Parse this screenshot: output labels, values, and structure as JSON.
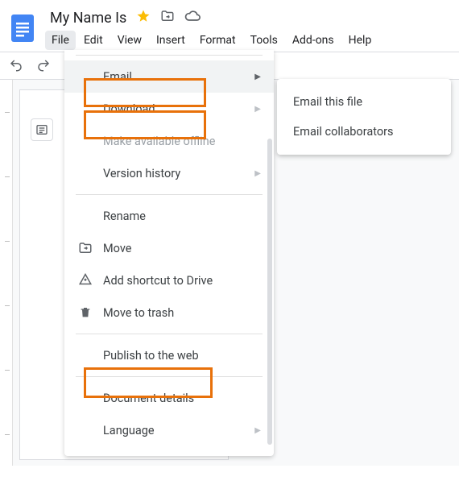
{
  "doc": {
    "title": "My Name Is"
  },
  "menubar": {
    "file": "File",
    "edit": "Edit",
    "view": "View",
    "insert": "Insert",
    "format": "Format",
    "tools": "Tools",
    "addons": "Add-ons",
    "help": "Help"
  },
  "dropdown": {
    "email": "Email",
    "download": "Download",
    "make_available_offline": "Make available offline",
    "version_history": "Version history",
    "rename": "Rename",
    "move": "Move",
    "add_shortcut": "Add shortcut to Drive",
    "move_to_trash": "Move to trash",
    "publish": "Publish to the web",
    "document_details": "Document details",
    "language": "Language"
  },
  "submenu": {
    "email_this_file": "Email this file",
    "email_collaborators": "Email collaborators"
  }
}
